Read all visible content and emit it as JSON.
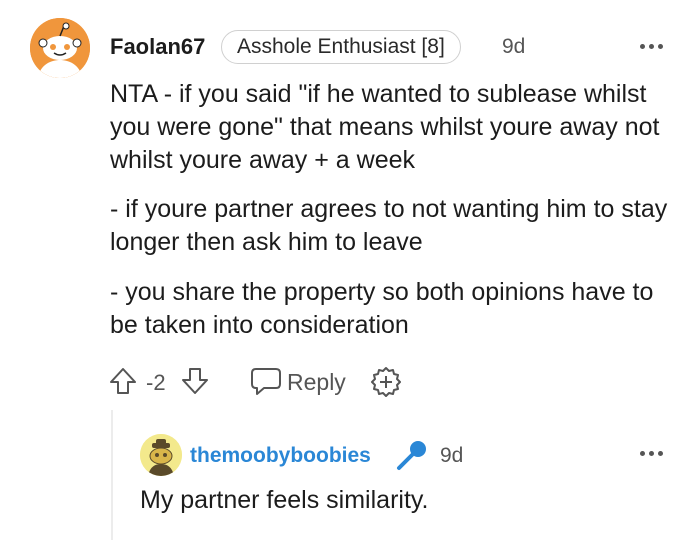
{
  "comment": {
    "username": "Faolan67",
    "flair": "Asshole Enthusiast [8]",
    "time": "9d",
    "paragraphs": [
      "NTA - if you said \"if he wanted to sublease whilst you were gone\" that means whilst youre away not whilst youre away + a week",
      "- if youre partner agrees to not wanting him to stay longer then ask him to leave",
      "- you share the property so both opinions have to be taken into consideration"
    ],
    "score": "-2",
    "reply_label": "Reply",
    "icons": [
      "snoo-avatar",
      "more-options-icon",
      "upvote-icon",
      "downvote-icon",
      "reply-icon",
      "award-icon"
    ],
    "colors": {
      "avatar_bg": "#f0963c"
    }
  },
  "reply": {
    "username": "themoobyboobies",
    "time": "9d",
    "text": "My partner feels similarity.",
    "icons": [
      "snoo-avatar",
      "microphone-icon",
      "more-options-icon"
    ],
    "colors": {
      "username": "#2a87d6",
      "mic": "#2a87d6"
    }
  }
}
